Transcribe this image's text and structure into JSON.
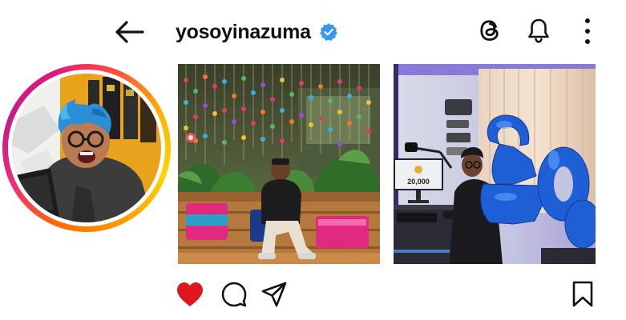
{
  "header": {
    "username": "yosoyinazuma",
    "verified": true,
    "icons": [
      "back-arrow-icon",
      "verified-badge-icon",
      "threads-icon",
      "bell-icon",
      "more-vertical-icon"
    ]
  },
  "posts": [
    {
      "caption_visible": ""
    },
    {
      "counter_on_screen": "20,000"
    }
  ],
  "actions": {
    "liked": true,
    "like_color": "#e0161f",
    "icons": [
      "heart-icon",
      "comment-icon",
      "share-icon",
      "bookmark-icon"
    ]
  },
  "colors": {
    "verified_blue": "#3897f0",
    "text": "#111111"
  }
}
